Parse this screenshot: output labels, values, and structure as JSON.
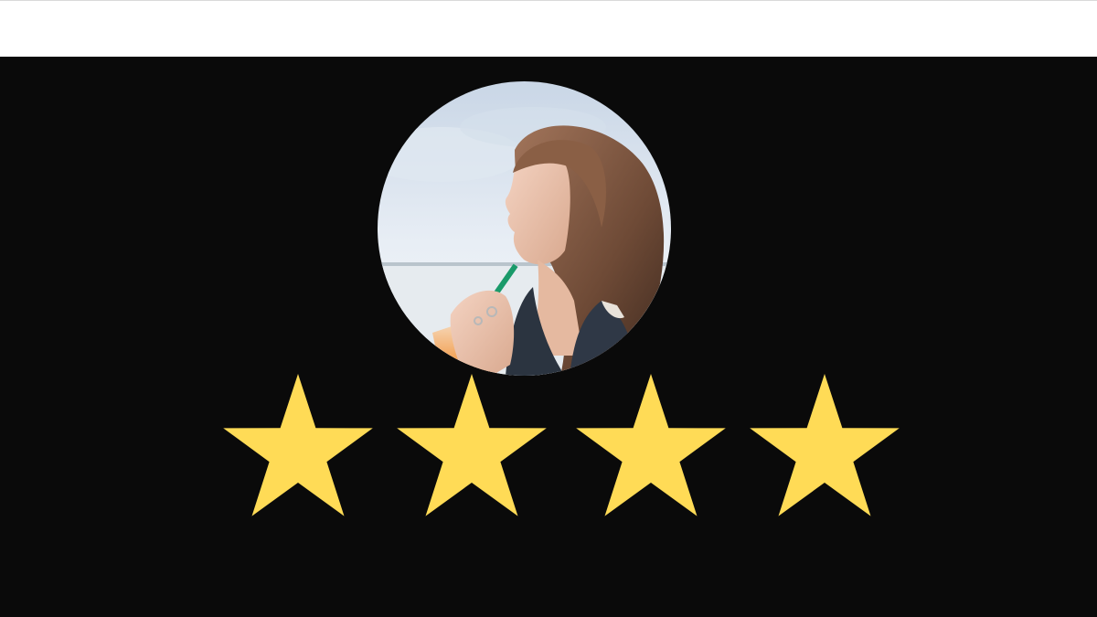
{
  "rating": {
    "filled": 4,
    "max": 4,
    "star_color": "#FFDB56"
  },
  "avatar": {
    "icon": "profile-photo"
  },
  "colors": {
    "background": "#0A0A0A",
    "top_strip": "#FFFFFF"
  }
}
